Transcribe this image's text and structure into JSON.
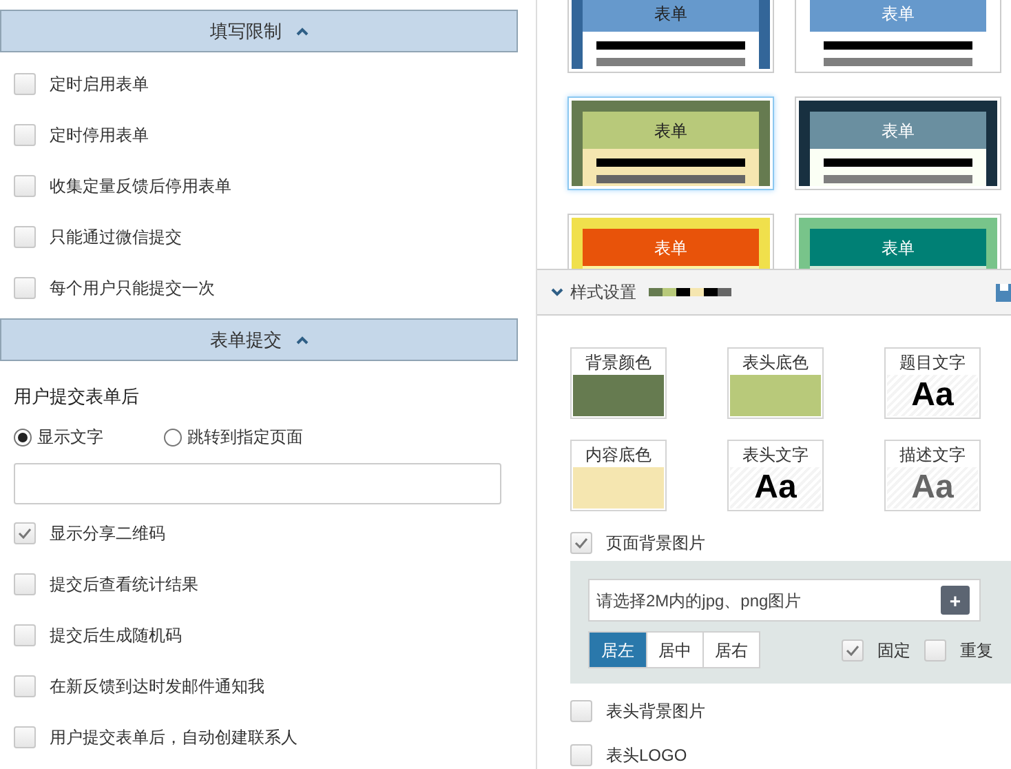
{
  "left": {
    "sections": [
      {
        "title": "填写限制",
        "expanded": true,
        "items": [
          {
            "kind": "checkbox",
            "label": "定时启用表单",
            "checked": false
          },
          {
            "kind": "checkbox",
            "label": "定时停用表单",
            "checked": false
          },
          {
            "kind": "checkbox",
            "label": "收集定量反馈后停用表单",
            "checked": false
          },
          {
            "kind": "checkbox",
            "label": "只能通过微信提交",
            "checked": false
          },
          {
            "kind": "checkbox",
            "label": "每个用户只能提交一次",
            "checked": false
          }
        ]
      },
      {
        "title": "表单提交",
        "expanded": true,
        "items": [
          {
            "kind": "heading",
            "label": "用户提交表单后"
          },
          {
            "kind": "radios",
            "options": [
              {
                "label": "显示文字",
                "selected": true
              },
              {
                "label": "跳转到指定页面",
                "selected": false
              }
            ]
          },
          {
            "kind": "textbox"
          },
          {
            "kind": "checkbox",
            "label": "显示分享二维码",
            "checked": true
          },
          {
            "kind": "checkbox",
            "label": "提交后查看统计结果",
            "checked": false
          },
          {
            "kind": "checkbox",
            "label": "提交后生成随机码",
            "checked": false
          },
          {
            "kind": "checkbox",
            "label": "在新反馈到达时发邮件通知我",
            "checked": false
          },
          {
            "kind": "checkbox",
            "label": "用户提交表单后，自动创建联系人",
            "checked": false
          }
        ]
      }
    ]
  },
  "templates": [
    {
      "label": "表单",
      "selected": false,
      "parts": [
        {
          "kind": "frame",
          "color": "#336699"
        },
        {
          "kind": "header",
          "color": "#6699cc"
        },
        {
          "kind": "text",
          "color": "#222222"
        },
        {
          "kind": "body",
          "color": "#ffffff"
        },
        {
          "kind": "line",
          "color": "#7f7f7f"
        }
      ]
    },
    {
      "label": "表单",
      "selected": false,
      "parts": [
        {
          "kind": "header",
          "color": "#6699cc"
        },
        {
          "kind": "text",
          "color": "#ffffff"
        },
        {
          "kind": "body",
          "color": "#ffffff"
        },
        {
          "kind": "line",
          "color": "#7f7f7f"
        }
      ]
    },
    {
      "label": "表单",
      "selected": true,
      "parts": [
        {
          "kind": "frame",
          "color": "#667b50"
        },
        {
          "kind": "header",
          "color": "#b8c97a"
        },
        {
          "kind": "text",
          "color": "#222222"
        },
        {
          "kind": "body",
          "color": "#f5e6b0"
        },
        {
          "kind": "line",
          "color": "#666666"
        }
      ]
    },
    {
      "label": "表单",
      "selected": false,
      "parts": [
        {
          "kind": "frame",
          "color": "#183040"
        },
        {
          "kind": "header",
          "color": "#6a8fa0"
        },
        {
          "kind": "text",
          "color": "#ffffff"
        },
        {
          "kind": "body",
          "color": "#fbfff5"
        },
        {
          "kind": "line",
          "color": "#7f7f7f"
        }
      ]
    },
    {
      "label": "表单",
      "selected": false,
      "parts": [
        {
          "kind": "frame",
          "color": "#f0e04c"
        },
        {
          "kind": "header",
          "color": "#e8530a"
        },
        {
          "kind": "text",
          "color": "#ffffff"
        },
        {
          "kind": "body",
          "color": "#fef4a0"
        }
      ]
    },
    {
      "label": "表单",
      "selected": false,
      "parts": [
        {
          "kind": "frame",
          "color": "#78c48a"
        },
        {
          "kind": "header",
          "color": "#008075"
        },
        {
          "kind": "text",
          "color": "#ffffff"
        },
        {
          "kind": "body",
          "color": "#d4e8d8"
        }
      ]
    }
  ],
  "style_settings": {
    "title": "样式设置",
    "expanded": true,
    "palette": [
      {
        "color": "#667b50"
      },
      {
        "color": "#b8c97a"
      },
      {
        "color": "#000000"
      },
      {
        "color": "#f5e6b0"
      },
      {
        "color": "#000000"
      },
      {
        "color": "#666666"
      }
    ],
    "swatches": [
      {
        "kind": "fill",
        "label": "背景颜色",
        "color": "#667b50"
      },
      {
        "kind": "fill",
        "label": "表头底色",
        "color": "#b8c97a"
      },
      {
        "kind": "font",
        "label": "题目文字",
        "sample": "Aa",
        "color": "#000000"
      },
      {
        "kind": "fill",
        "label": "内容底色",
        "color": "#f5e6b0"
      },
      {
        "kind": "font",
        "label": "表头文字",
        "sample": "Aa",
        "color": "#000000"
      },
      {
        "kind": "font",
        "label": "描述文字",
        "sample": "Aa",
        "color": "#666666"
      }
    ],
    "page_background": {
      "label": "页面背景图片",
      "checked": true,
      "placeholder": "请选择2M内的jpg、png图片",
      "add": "+",
      "align": [
        {
          "label": "居左",
          "selected": true
        },
        {
          "label": "居中",
          "selected": false
        },
        {
          "label": "居右",
          "selected": false
        }
      ],
      "options": [
        {
          "label": "固定",
          "checked": true
        },
        {
          "label": "重复",
          "checked": false
        }
      ]
    },
    "more": [
      {
        "label": "表头背景图片",
        "checked": false
      },
      {
        "label": "表头LOGO",
        "checked": false
      }
    ]
  }
}
